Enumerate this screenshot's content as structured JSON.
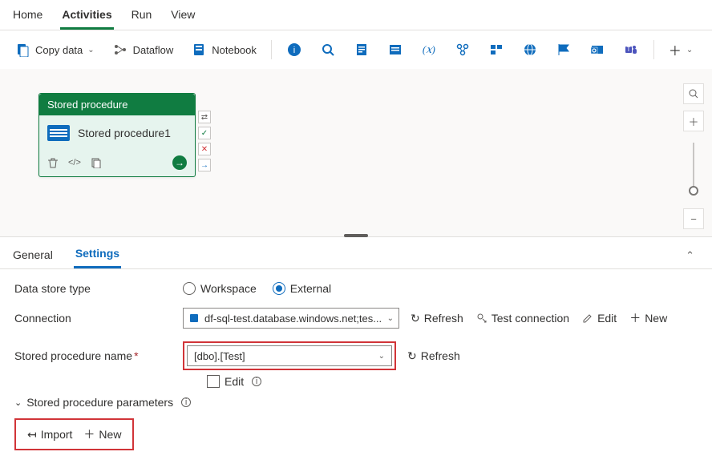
{
  "topTabs": {
    "home": "Home",
    "activities": "Activities",
    "run": "Run",
    "view": "View"
  },
  "toolbar": {
    "copyData": "Copy data",
    "dataflow": "Dataflow",
    "notebook": "Notebook"
  },
  "activity": {
    "headerTitle": "Stored procedure",
    "name": "Stored procedure1"
  },
  "panelTabs": {
    "general": "General",
    "settings": "Settings"
  },
  "settings": {
    "dataStoreTypeLabel": "Data store type",
    "workspace": "Workspace",
    "external": "External",
    "connectionLabel": "Connection",
    "connectionValue": "df-sql-test.database.windows.net;tes...",
    "refresh": "Refresh",
    "testConnection": "Test connection",
    "edit": "Edit",
    "new": "New",
    "spNameLabel": "Stored procedure name",
    "spNameValue": "[dbo].[Test]",
    "editCheckbox": "Edit",
    "spParamsHeader": "Stored procedure parameters",
    "import": "Import"
  }
}
